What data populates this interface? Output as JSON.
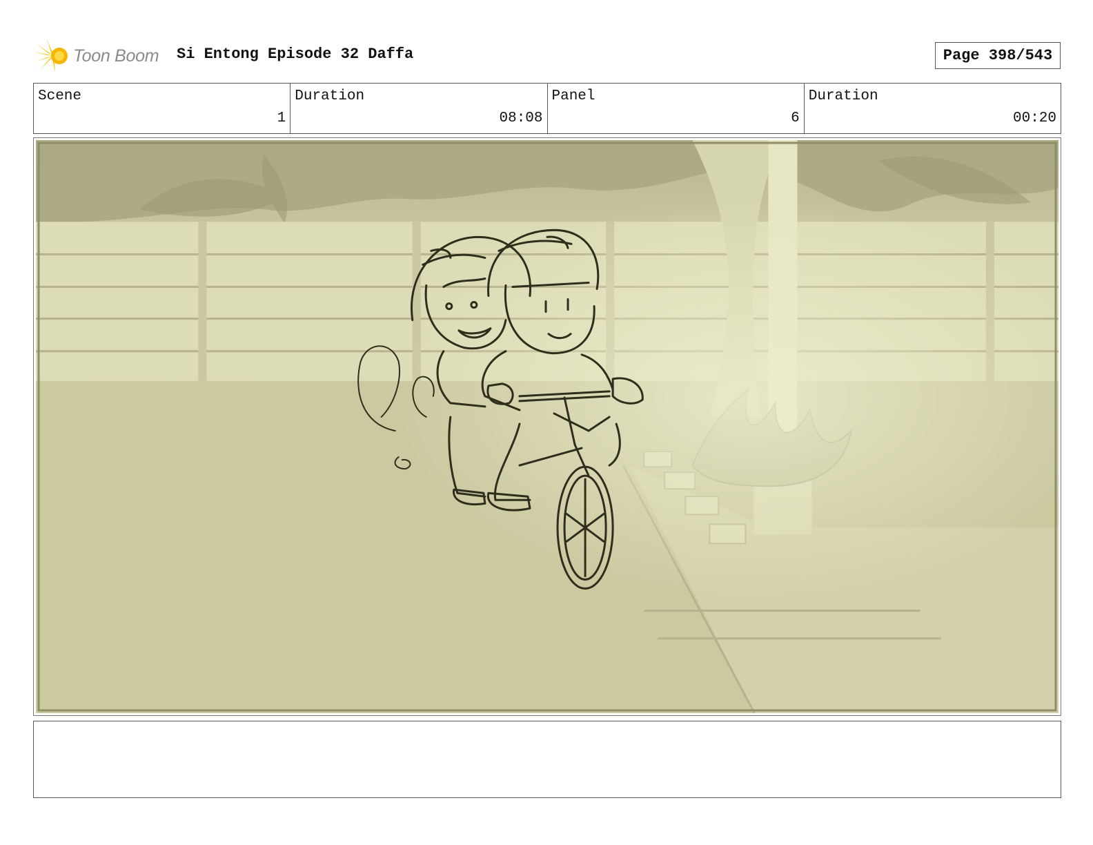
{
  "header": {
    "logo_text": "Toon Boom",
    "title": "Si Entong Episode 32 Daffa",
    "page_label": "Page 398/543"
  },
  "info": {
    "scene_label": "Scene",
    "scene_value": "1",
    "scene_duration_label": "Duration",
    "scene_duration_value": "08:08",
    "panel_label": "Panel",
    "panel_value": "6",
    "panel_duration_label": "Duration",
    "panel_duration_value": "00:20"
  },
  "notes": {
    "text": ""
  },
  "colors": {
    "panel_tint": "#cfcfa8",
    "sketch_line": "#2f2d1c",
    "logo_yellow": "#f5c400",
    "logo_text": "#8a8a8a"
  }
}
